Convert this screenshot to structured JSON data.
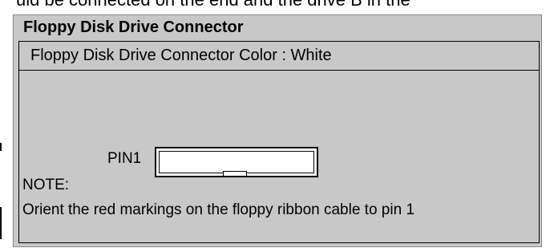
{
  "page": {
    "top_text": "uld be connected on the end and the drive B in the"
  },
  "panel": {
    "title": "Floppy Disk Drive Connector",
    "color_line": "Floppy Disk Drive Connector Color : White",
    "pin_label": "PIN1",
    "note_label": "NOTE:",
    "note_text": "Orient the red markings on the floppy ribbon cable to pin 1"
  },
  "colors": {
    "panel_background": "#c8c8c8",
    "connector_fill": "#ffffff",
    "text": "#000000"
  }
}
